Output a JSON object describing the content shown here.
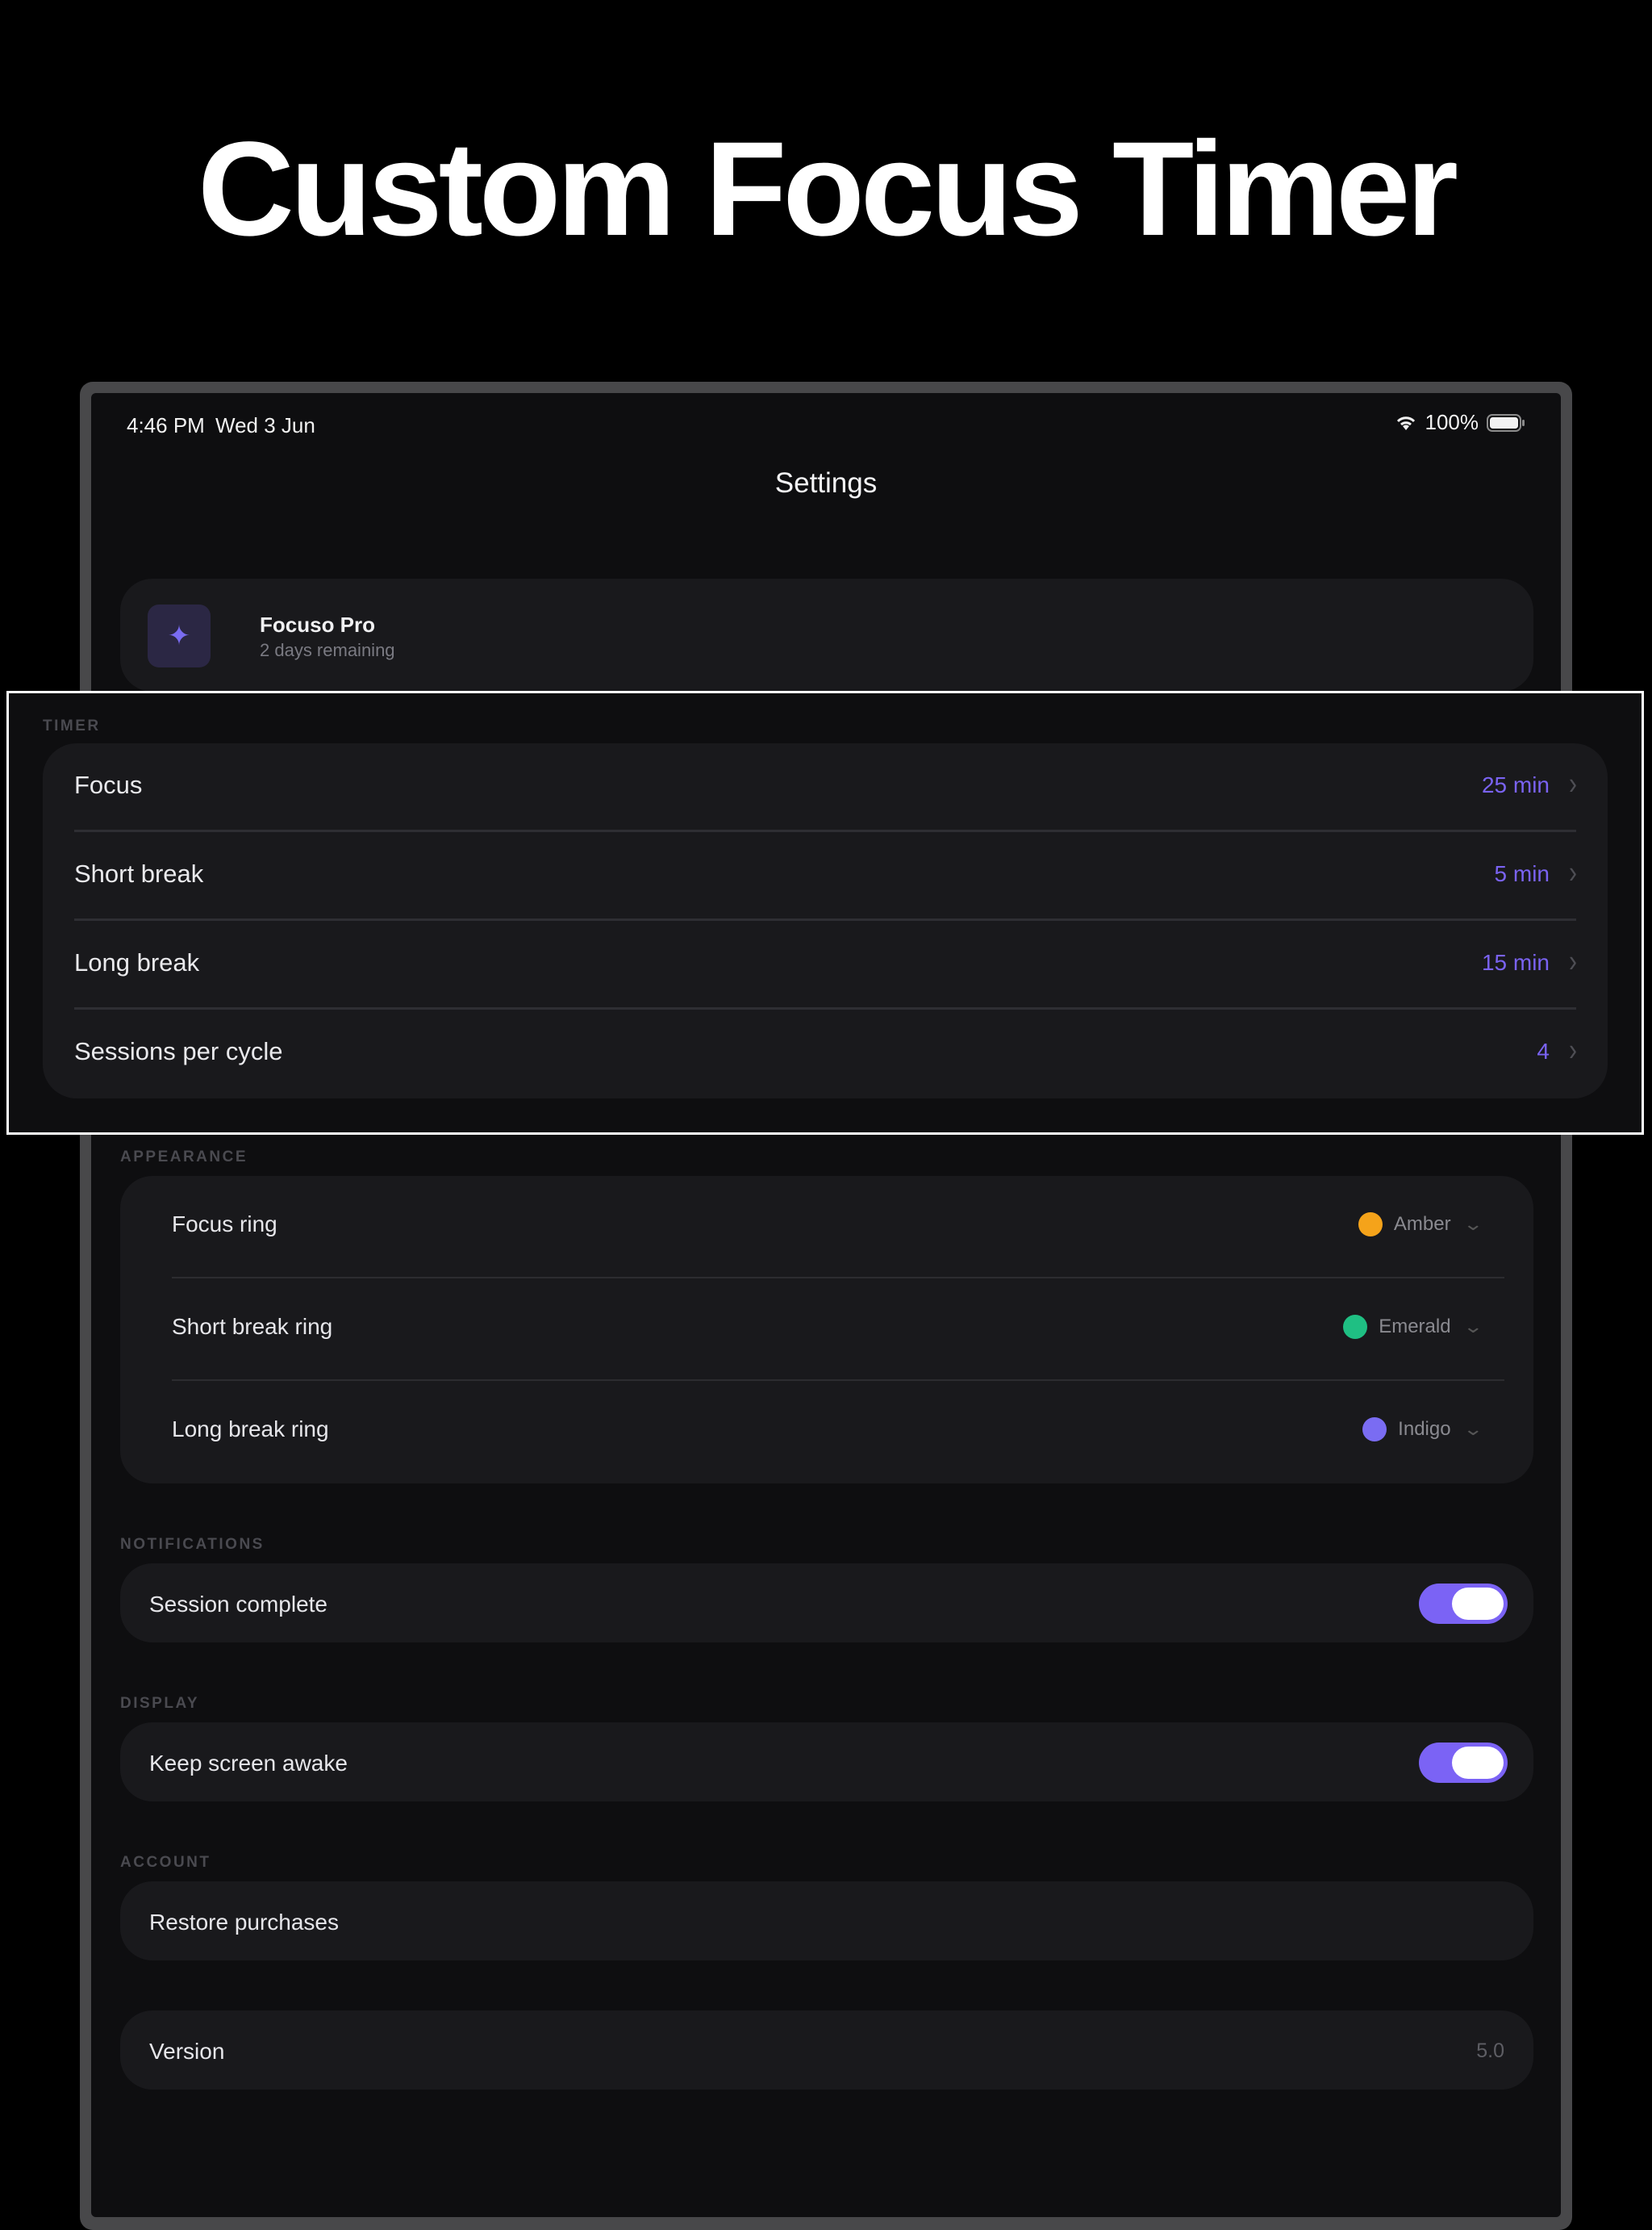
{
  "headline": "Custom Focus Timer",
  "status_bar": {
    "time": "4:46 PM",
    "date": "Wed 3 Jun",
    "battery": "100%"
  },
  "nav": {
    "title": "Settings"
  },
  "pro": {
    "title": "Focuso Pro",
    "subtitle": "2 days remaining",
    "icon": "sparkle-icon",
    "accent": "#7a6cf2"
  },
  "timer": {
    "label": "TIMER",
    "rows": [
      {
        "label": "Focus",
        "value": "25 min"
      },
      {
        "label": "Short break",
        "value": "5 min"
      },
      {
        "label": "Long break",
        "value": "15 min"
      },
      {
        "label": "Sessions per cycle",
        "value": "4"
      }
    ]
  },
  "appearance": {
    "label": "APPEARANCE",
    "rows": [
      {
        "label": "Focus ring",
        "value": "Amber",
        "color": "#f5a31a"
      },
      {
        "label": "Short break ring",
        "value": "Emerald",
        "color": "#1fbf83"
      },
      {
        "label": "Long break ring",
        "value": "Indigo",
        "color": "#7a6cf2"
      }
    ]
  },
  "notifications": {
    "label": "NOTIFICATIONS",
    "session_complete": "Session complete",
    "enabled": true
  },
  "display": {
    "label": "DISPLAY",
    "keep_awake": "Keep screen awake",
    "enabled": true
  },
  "account": {
    "label": "ACCOUNT",
    "restore": "Restore purchases"
  },
  "version": {
    "label": "Version",
    "value": "5.0"
  }
}
